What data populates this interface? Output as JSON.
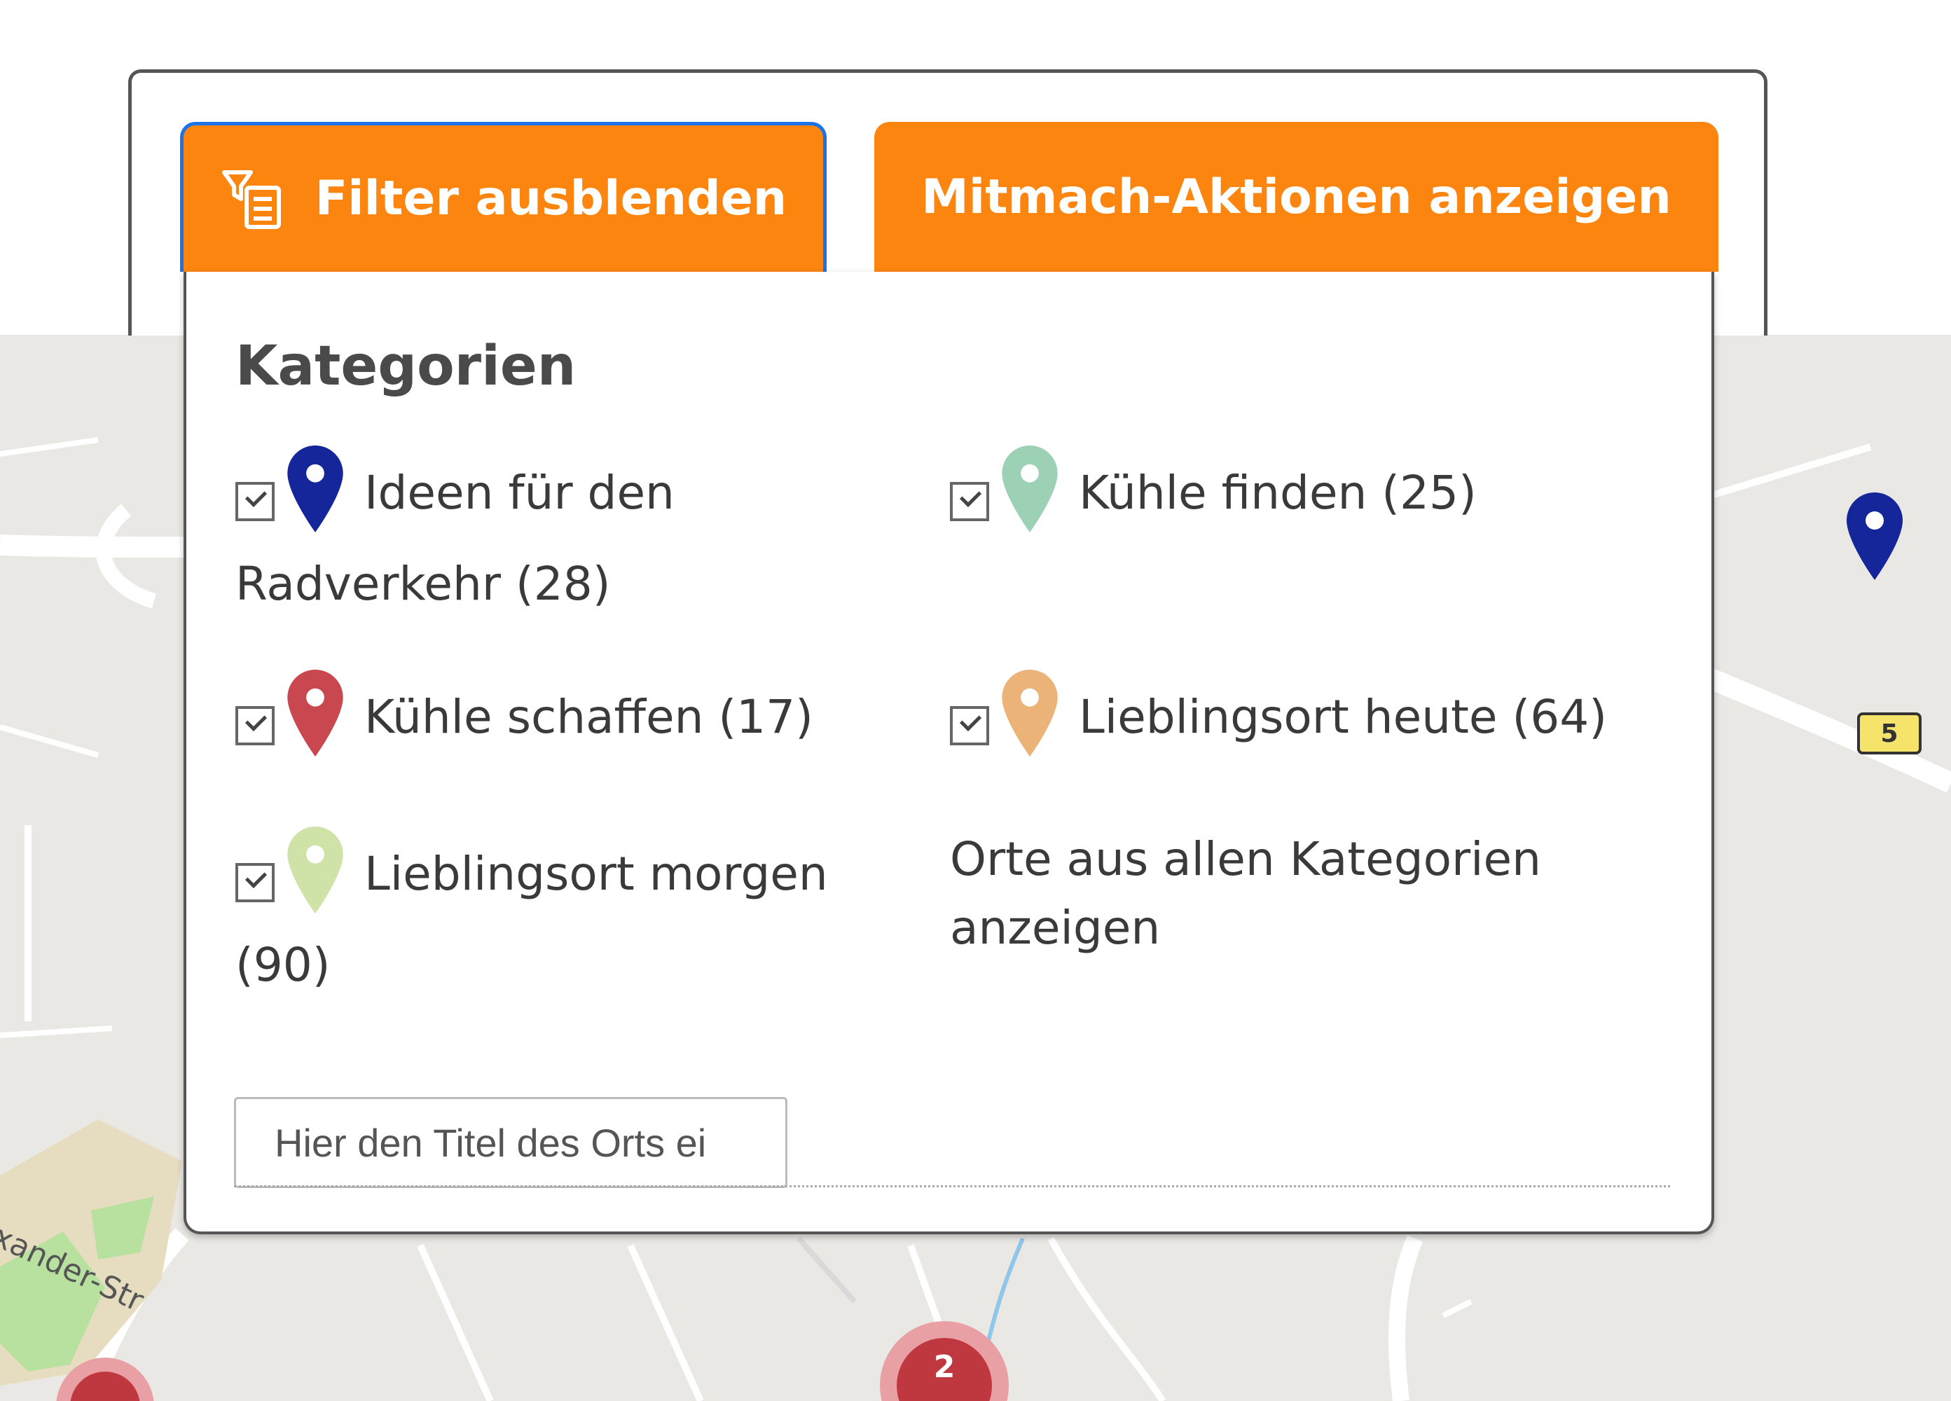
{
  "toolbar": {
    "filter_label": "Filter ausblenden",
    "actions_label": "Mitmach-Aktionen anzeigen",
    "filter_icon": "filter-list-icon"
  },
  "colors": {
    "accent": "#fc8510",
    "focus": "#1a73e8",
    "pin_radverkehr": "#15269a",
    "pin_kuehle_finden": "#9dd1b5",
    "pin_kuehle_schaffen": "#c9484f",
    "pin_lieblingsort_heute": "#ebb377",
    "pin_lieblingsort_morgen": "#cfe3a8"
  },
  "filter": {
    "heading": "Kategorien",
    "categories": [
      {
        "label": "Ideen für den Radverkehr (28)",
        "checked": true,
        "icon": "map-pin-icon"
      },
      {
        "label": "Kühle finden (25)",
        "checked": true,
        "icon": "map-pin-icon"
      },
      {
        "label": "Kühle schaffen (17)",
        "checked": true,
        "icon": "map-pin-icon"
      },
      {
        "label": "Lieblingsort heute (64)",
        "checked": true,
        "icon": "map-pin-icon"
      },
      {
        "label": "Lieblingsort morgen (90)",
        "checked": true,
        "icon": "map-pin-icon"
      }
    ],
    "show_all_label": "Orte aus allen Kategorien anzeigen",
    "search_placeholder": "Hier den Titel des Orts ei"
  },
  "map": {
    "street_label": "exander-Str",
    "road_shield": "5",
    "cluster_count": "2"
  }
}
